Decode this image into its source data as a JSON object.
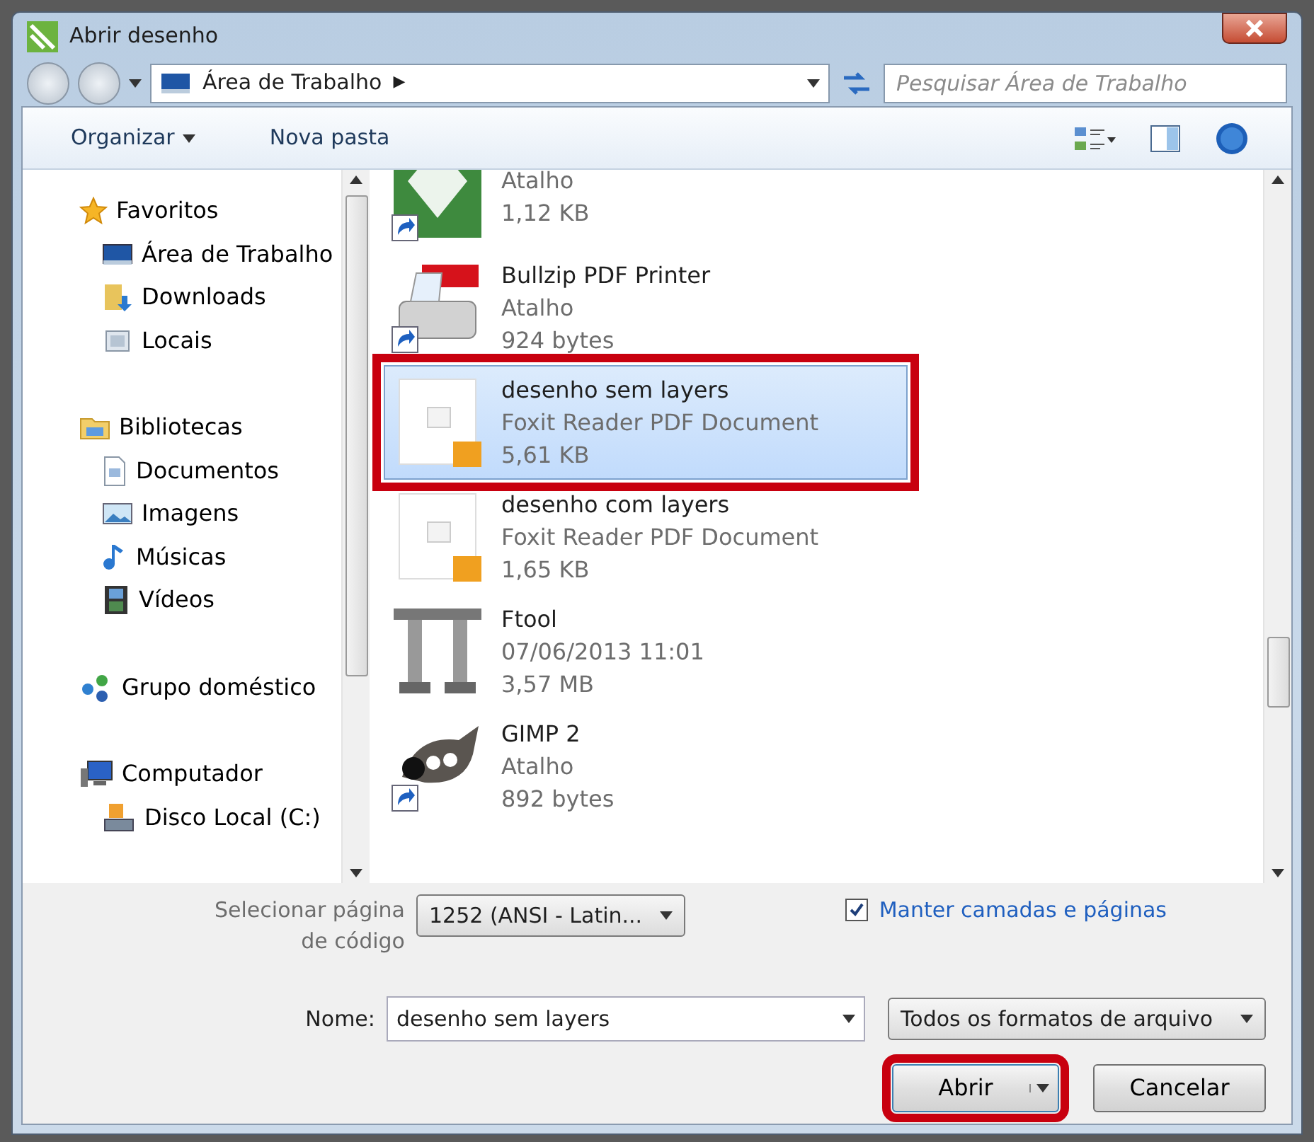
{
  "window": {
    "title": "Abrir desenho"
  },
  "address_bar": {
    "location": "Área de Trabalho",
    "separator": "▶"
  },
  "search": {
    "placeholder": "Pesquisar Área de Trabalho"
  },
  "toolbar": {
    "organize": "Organizar",
    "new_folder": "Nova pasta"
  },
  "sidebar": {
    "groups": [
      {
        "label": "Favoritos",
        "children": [
          {
            "label": "Área de Trabalho"
          },
          {
            "label": "Downloads"
          },
          {
            "label": "Locais"
          }
        ]
      },
      {
        "label": "Bibliotecas",
        "children": [
          {
            "label": "Documentos"
          },
          {
            "label": "Imagens"
          },
          {
            "label": "Músicas"
          },
          {
            "label": "Vídeos"
          }
        ]
      },
      {
        "label": "Grupo doméstico"
      },
      {
        "label": "Computador",
        "children": [
          {
            "label": "Disco Local (C:)"
          }
        ]
      }
    ]
  },
  "files": [
    {
      "shortcut": true,
      "type": "Atalho",
      "size": "1,12 KB",
      "selected": false
    },
    {
      "name": "Bullzip PDF Printer",
      "shortcut": true,
      "type": "Atalho",
      "size": "924 bytes",
      "selected": false
    },
    {
      "name": "desenho sem layers",
      "shortcut": false,
      "type": "Foxit Reader PDF Document",
      "size": "5,61 KB",
      "selected": true,
      "highlighted": true
    },
    {
      "name": "desenho com layers",
      "shortcut": false,
      "type": "Foxit Reader PDF Document",
      "size": "1,65 KB",
      "selected": false
    },
    {
      "name": "Ftool",
      "shortcut": false,
      "type": "07/06/2013 11:01",
      "size": "3,57 MB",
      "selected": false
    },
    {
      "name": "GIMP 2",
      "shortcut": true,
      "type": "Atalho",
      "size": "892 bytes",
      "selected": false
    }
  ],
  "options": {
    "codepage_label": "Selecionar página de código",
    "codepage_value": "1252  (ANSI - Latin...",
    "keep_layers": {
      "label": "Manter camadas e páginas",
      "checked": true
    }
  },
  "filename": {
    "label": "Nome:",
    "value": "desenho sem layers"
  },
  "filter": {
    "value": "Todos os formatos de arquivo"
  },
  "buttons": [
    {
      "label": "Abrir",
      "kind": "split",
      "highlighted": true
    },
    {
      "label": "Cancelar",
      "kind": "plain",
      "highlighted": false
    }
  ]
}
